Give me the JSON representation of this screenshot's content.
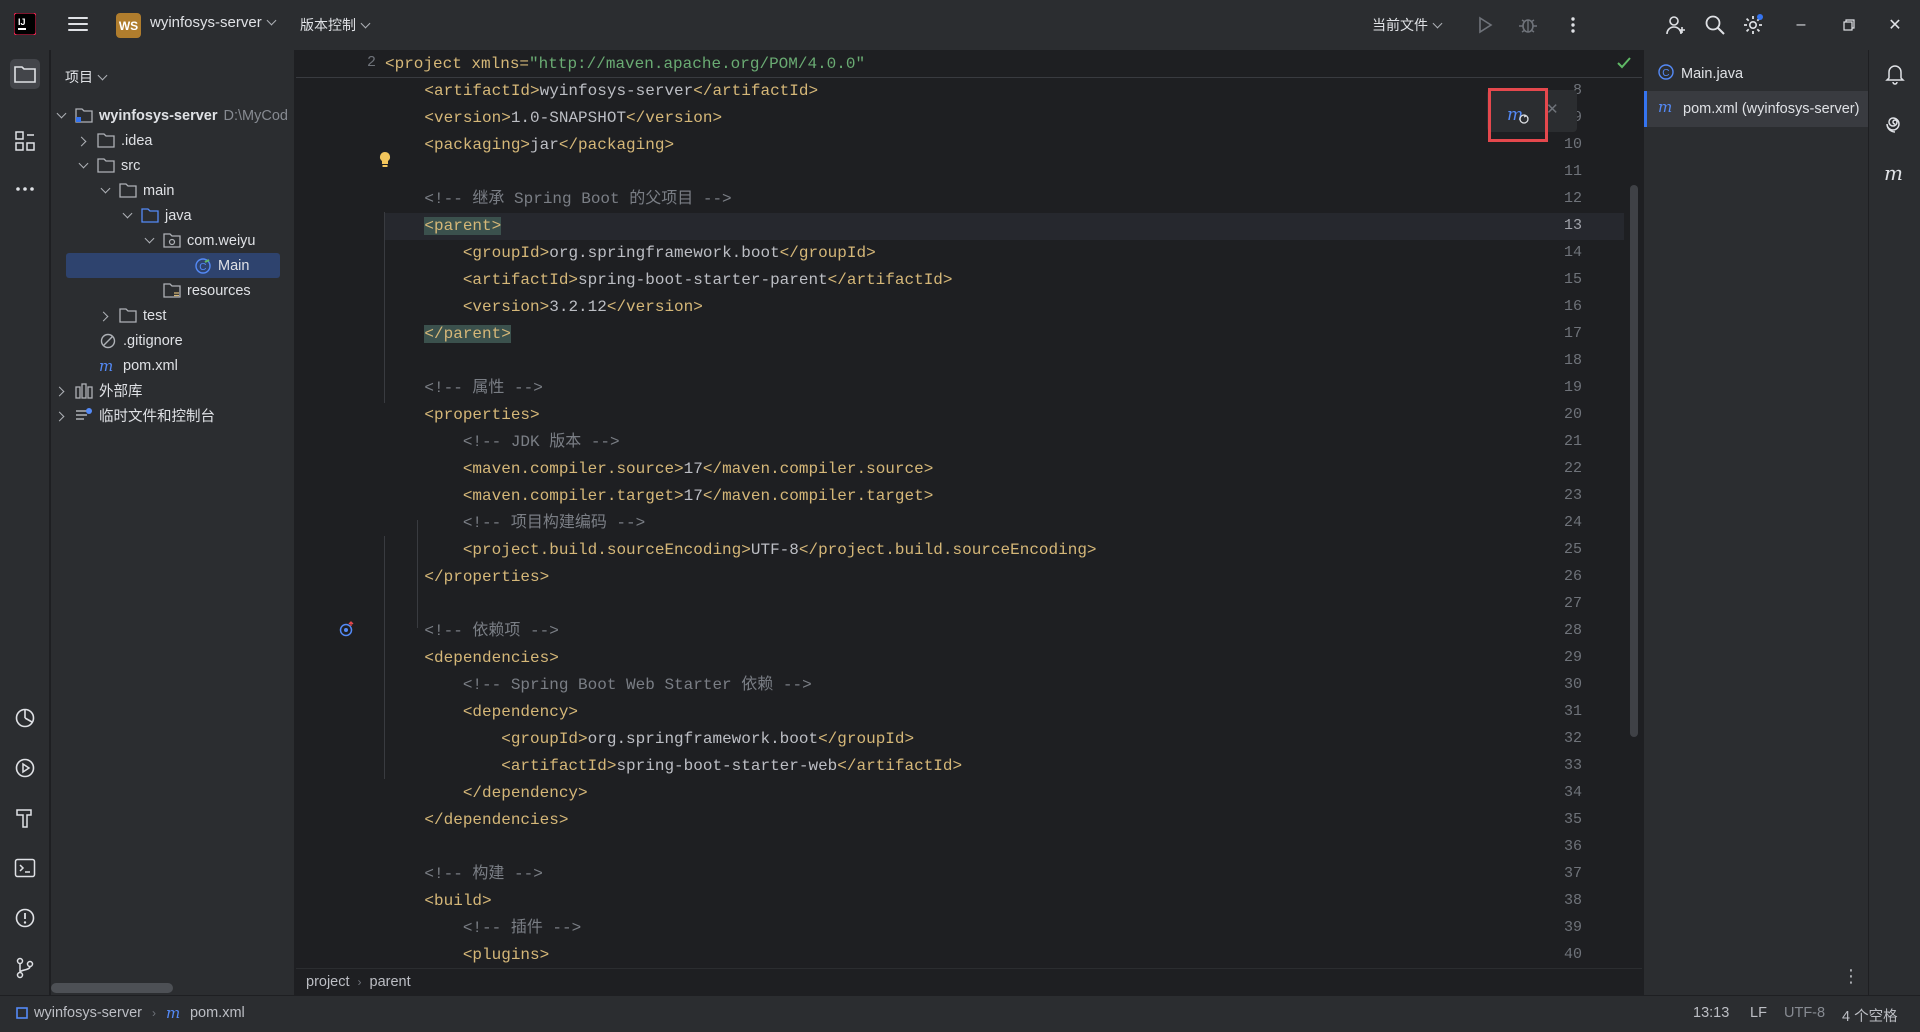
{
  "titlebar": {
    "project_badge": "WS",
    "project_name": "wyinfosys-server",
    "vcs_label": "版本控制",
    "run_config": "当前文件"
  },
  "project_panel": {
    "title": "项目",
    "tree": [
      {
        "label": "wyinfosys-server",
        "hint": "D:\\MyCod",
        "icon": "module-folder-icon"
      },
      {
        "label": ".idea",
        "icon": "folder-icon"
      },
      {
        "label": "src",
        "icon": "folder-icon"
      },
      {
        "label": "main",
        "icon": "folder-icon"
      },
      {
        "label": "java",
        "icon": "source-folder-icon"
      },
      {
        "label": "com.weiyu",
        "icon": "package-icon"
      },
      {
        "label": "Main",
        "icon": "java-class-icon"
      },
      {
        "label": "resources",
        "icon": "resources-folder-icon"
      },
      {
        "label": "test",
        "icon": "folder-icon"
      },
      {
        "label": ".gitignore",
        "icon": "ignore-file-icon"
      },
      {
        "label": "pom.xml",
        "icon": "maven-icon"
      },
      {
        "label": "外部库",
        "icon": "library-icon"
      },
      {
        "label": "临时文件和控制台",
        "icon": "scratch-icon"
      }
    ]
  },
  "editor": {
    "sticky_line_number": "2",
    "sticky_line": {
      "tag_open": "<project xmlns=",
      "value": "\"http://maven.apache.org/POM/4.0.0\""
    },
    "current_line": "13",
    "lines": [
      {
        "n": "8",
        "parts": [
          [
            "    ",
            "txt"
          ],
          [
            "<artifactId>",
            "tag"
          ],
          [
            "wyinfosys-server",
            "txt"
          ],
          [
            "</artifactId>",
            "tag"
          ]
        ]
      },
      {
        "n": "9",
        "parts": [
          [
            "    ",
            "txt"
          ],
          [
            "<version>",
            "tag"
          ],
          [
            "1.0-SNAPSHOT",
            "txt"
          ],
          [
            "</version>",
            "tag"
          ]
        ]
      },
      {
        "n": "10",
        "parts": [
          [
            "    ",
            "txt"
          ],
          [
            "<packaging>",
            "tag"
          ],
          [
            "jar",
            "txt"
          ],
          [
            "</packaging>",
            "tag"
          ]
        ]
      },
      {
        "n": "11",
        "parts": []
      },
      {
        "n": "12",
        "parts": [
          [
            "    ",
            "txt"
          ],
          [
            "<!-- 继承 Spring Boot 的父项目 -->",
            "cmt"
          ]
        ]
      },
      {
        "n": "13",
        "parts": [
          [
            "    ",
            "txt"
          ],
          [
            "<parent>",
            "tag hl"
          ]
        ]
      },
      {
        "n": "14",
        "parts": [
          [
            "        ",
            "txt"
          ],
          [
            "<groupId>",
            "tag"
          ],
          [
            "org.springframework.boot",
            "txt"
          ],
          [
            "</groupId>",
            "tag"
          ]
        ]
      },
      {
        "n": "15",
        "parts": [
          [
            "        ",
            "txt"
          ],
          [
            "<artifactId>",
            "tag"
          ],
          [
            "spring-boot-starter-parent",
            "txt"
          ],
          [
            "</artifactId>",
            "tag"
          ]
        ]
      },
      {
        "n": "16",
        "parts": [
          [
            "        ",
            "txt"
          ],
          [
            "<version>",
            "tag"
          ],
          [
            "3.2.12",
            "txt"
          ],
          [
            "</version>",
            "tag"
          ]
        ]
      },
      {
        "n": "17",
        "parts": [
          [
            "    ",
            "txt"
          ],
          [
            "</parent>",
            "tag hl"
          ]
        ]
      },
      {
        "n": "18",
        "parts": []
      },
      {
        "n": "19",
        "parts": [
          [
            "    ",
            "txt"
          ],
          [
            "<!-- 属性 -->",
            "cmt"
          ]
        ]
      },
      {
        "n": "20",
        "parts": [
          [
            "    ",
            "txt"
          ],
          [
            "<properties>",
            "tag"
          ]
        ]
      },
      {
        "n": "21",
        "parts": [
          [
            "        ",
            "txt"
          ],
          [
            "<!-- JDK 版本 -->",
            "cmt"
          ]
        ]
      },
      {
        "n": "22",
        "parts": [
          [
            "        ",
            "txt"
          ],
          [
            "<maven.compiler.source>",
            "tag"
          ],
          [
            "17",
            "txt"
          ],
          [
            "</maven.compiler.source>",
            "tag"
          ]
        ]
      },
      {
        "n": "23",
        "parts": [
          [
            "        ",
            "txt"
          ],
          [
            "<maven.compiler.target>",
            "tag"
          ],
          [
            "17",
            "txt"
          ],
          [
            "</maven.compiler.target>",
            "tag"
          ]
        ]
      },
      {
        "n": "24",
        "parts": [
          [
            "        ",
            "txt"
          ],
          [
            "<!-- 项目构建编码 -->",
            "cmt"
          ]
        ]
      },
      {
        "n": "25",
        "parts": [
          [
            "        ",
            "txt"
          ],
          [
            "<project.build.sourceEncoding>",
            "tag"
          ],
          [
            "UTF-8",
            "txt"
          ],
          [
            "</project.build.sourceEncoding>",
            "tag"
          ]
        ]
      },
      {
        "n": "26",
        "parts": [
          [
            "    ",
            "txt"
          ],
          [
            "</properties>",
            "tag"
          ]
        ]
      },
      {
        "n": "27",
        "parts": []
      },
      {
        "n": "28",
        "parts": [
          [
            "    ",
            "txt"
          ],
          [
            "<!-- 依赖项 -->",
            "cmt"
          ]
        ]
      },
      {
        "n": "29",
        "parts": [
          [
            "    ",
            "txt"
          ],
          [
            "<dependencies>",
            "tag"
          ]
        ]
      },
      {
        "n": "30",
        "parts": [
          [
            "        ",
            "txt"
          ],
          [
            "<!-- Spring Boot Web Starter 依赖 -->",
            "cmt"
          ]
        ]
      },
      {
        "n": "31",
        "parts": [
          [
            "        ",
            "txt"
          ],
          [
            "<dependency>",
            "tag"
          ]
        ]
      },
      {
        "n": "32",
        "parts": [
          [
            "            ",
            "txt"
          ],
          [
            "<groupId>",
            "tag"
          ],
          [
            "org.springframework.boot",
            "txt"
          ],
          [
            "</groupId>",
            "tag"
          ]
        ]
      },
      {
        "n": "33",
        "parts": [
          [
            "            ",
            "txt"
          ],
          [
            "<artifactId>",
            "tag"
          ],
          [
            "spring-boot-starter-web",
            "txt"
          ],
          [
            "</artifactId>",
            "tag"
          ]
        ]
      },
      {
        "n": "34",
        "parts": [
          [
            "        ",
            "txt"
          ],
          [
            "</dependency>",
            "tag"
          ]
        ]
      },
      {
        "n": "35",
        "parts": [
          [
            "    ",
            "txt"
          ],
          [
            "</dependencies>",
            "tag"
          ]
        ]
      },
      {
        "n": "36",
        "parts": []
      },
      {
        "n": "37",
        "parts": [
          [
            "    ",
            "txt"
          ],
          [
            "<!-- 构建 -->",
            "cmt"
          ]
        ]
      },
      {
        "n": "38",
        "parts": [
          [
            "    ",
            "txt"
          ],
          [
            "<build>",
            "tag"
          ]
        ]
      },
      {
        "n": "39",
        "parts": [
          [
            "        ",
            "txt"
          ],
          [
            "<!-- 插件 -->",
            "cmt"
          ]
        ]
      },
      {
        "n": "40",
        "parts": [
          [
            "        ",
            "txt"
          ],
          [
            "<plugins>",
            "tag"
          ]
        ]
      }
    ]
  },
  "breadcrumb": [
    "project",
    "parent"
  ],
  "recent_files": [
    {
      "label": "Main.java",
      "icon": "java-class-icon"
    },
    {
      "label": "pom.xml (wyinfosys-server)",
      "icon": "maven-icon"
    }
  ],
  "statusbar": {
    "module": "wyinfosys-server",
    "file": "pom.xml",
    "position": "13:13",
    "line_sep": "LF",
    "encoding": "UTF-8",
    "indent": "4 个空格"
  }
}
